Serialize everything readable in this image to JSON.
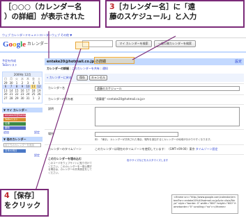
{
  "callouts": {
    "c1": {
      "line1": "［○○○（カレンダー名",
      "line2": "）の詳細］が表示された"
    },
    "c3": {
      "number": "3",
      "line1": "［カレンダー名］に「遠",
      "line2": "藤のスケジュール」と入力"
    },
    "c4": {
      "number": "4",
      "line1": "［保存］",
      "line2": "をクリック"
    }
  },
  "topnav": {
    "items": [
      "ウェブ",
      "カレンダー",
      "ドキュメント",
      "リーダー",
      "ウェブ",
      "その他 ▼"
    ]
  },
  "header": {
    "logo_letters": [
      "G",
      "o",
      "o",
      "g",
      "l",
      "e"
    ],
    "product": "カレンダー",
    "buttons": [
      "マイ カレンダーを検索",
      "一般公開カレンダーを検索"
    ]
  },
  "sidebar": {
    "links": [
      "予定を作成",
      "ToDoリスト"
    ],
    "mini_calendar": {
      "month": "2009年 12月",
      "weekdays": [
        "日",
        "月",
        "火",
        "水",
        "木",
        "金",
        "土"
      ],
      "days": [
        "29",
        "30",
        "1",
        "2",
        "3",
        "4",
        "5",
        "6",
        "7",
        "8",
        "9",
        "10",
        "11",
        "12",
        "13",
        "14",
        "15",
        "16",
        "17",
        "18",
        "19",
        "20",
        "21",
        "22",
        "23",
        "24",
        "25",
        "26",
        "27",
        "28",
        "29",
        "30",
        "31",
        "1",
        "2"
      ]
    },
    "my_calendars_label": "▼ マイ カレンダー",
    "calendars": [
      {
        "name": "entake20@hotmail.co.jp",
        "color": "#cf4a63"
      },
      {
        "name": "ToDoリスト",
        "color": "#d98c2b"
      },
      {
        "name": "仕事",
        "color": "#3d8a45"
      },
      {
        "name": "趣味",
        "color": "#5a6fc9"
      }
    ],
    "add_link": "追加",
    "settings_link": "設定",
    "other_calendars_label": "▼ 他のカレンダー",
    "friend_placeholder": "友だちのカレンダーを追加",
    "other_items": [
      "日本の祝日",
      "設定"
    ]
  },
  "main": {
    "title": "entake20@hotmail.co.jp の詳細",
    "settings_link": "設定",
    "tabs": [
      "カレンダーの詳細",
      "このカレンダーを共有",
      "通知"
    ],
    "back_link": "« カレンダーに戻る",
    "save_label": "保存",
    "cancel_label": "キャンセル",
    "fields": {
      "name_label": "カレンダー名",
      "name_value": "遠藤のスケジュール",
      "owner_label": "カレンダーの所有者",
      "owner_value": "\"遠藤健\" <entake20@hotmail.co.jp>",
      "description_label": "説明",
      "location_label": "場所",
      "location_hint": "例：「東京」 カレンダーが共有された場合、場所を追加するとカレンダーの地域が分かりやすくなります。",
      "timezone_label": "カレンダーのタイムゾーン",
      "timezone_value": "このカレンダーは現在のタイムゾーンを使用しています：（GMT+09:00）東京",
      "timezone_link": "タイムゾーン設定",
      "embed_label": "このカレンダーを埋め込む",
      "embed_hint": "このコードをウェブサイトに貼り付けてください。このカレンダーを一般公開する場合は、カレンダーの共有設定をしてください。",
      "embed_link": "色やサイズなどをカスタマイズします",
      "embed_code": "<iframe src=\"http://www.google.com/calendar/embed?src=entake20%40hotmail.co.jp&ctz=Asia/Tokyo\" style=\"border: 0\" width=\"800\" height=\"600\" frameborder=\"0\" scrolling=\"no\"></iframe>"
    }
  },
  "colors": {
    "accent": "#c3d9ff",
    "callout_border": "#7a2a78",
    "callout_number": "#c0282c",
    "highlight": "#e8a63a"
  }
}
